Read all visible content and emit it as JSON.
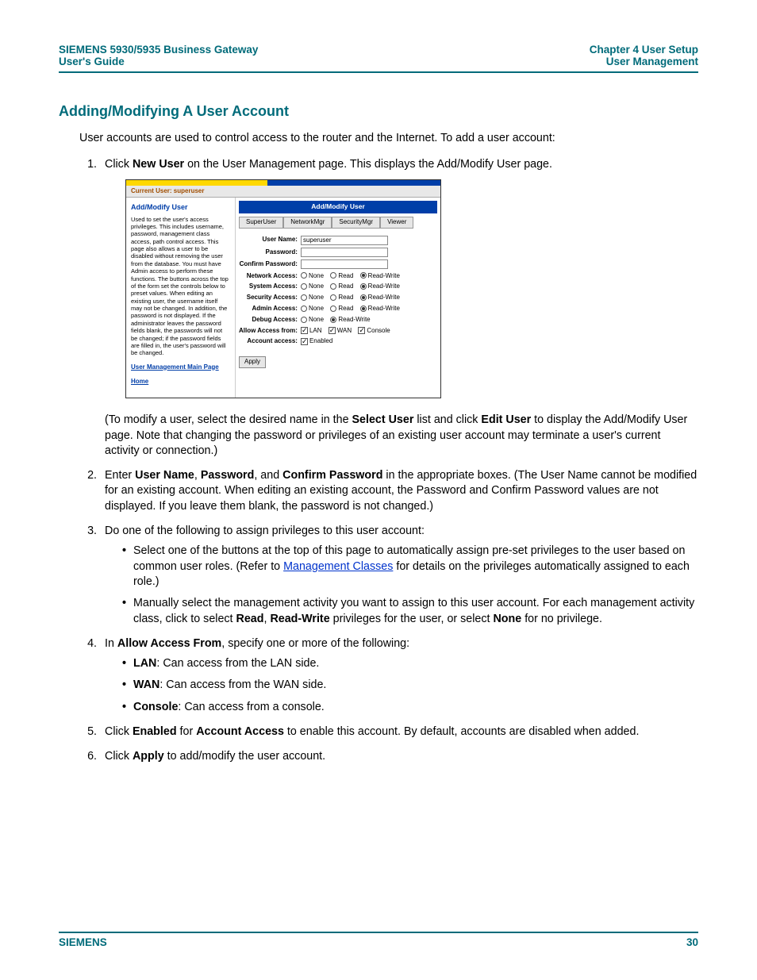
{
  "header": {
    "left_line1": "SIEMENS 5930/5935 Business Gateway",
    "left_line2": "User's Guide",
    "right_line1": "Chapter 4  User Setup",
    "right_line2": "User Management"
  },
  "section_title": "Adding/Modifying A User Account",
  "intro": "User accounts are used to control access to the router and the Internet. To add a user account:",
  "step1": {
    "pre": "Click ",
    "bold": "New User",
    "post": " on the User Management page. This displays the Add/Modify User page."
  },
  "shot": {
    "current_user_label": "Current User: superuser",
    "side_title": "Add/Modify User",
    "side_text": "Used to set the user's access privileges. This includes username, password, management class access, path control access. This page also allows a user to be disabled without removing the user from the database. You must have Admin access to perform these functions. The buttons across the top of the form set the controls below to preset values.\nWhen editing an existing user, the username itself may not be changed. In addition, the password is not displayed. If the administrator leaves the password fields blank, the passwords will not be changed; if the password fields are filled in, the user's password will be changed.",
    "side_link1": "User Management Main Page",
    "side_link2": "Home",
    "panel_title": "Add/Modify User",
    "roles": [
      "SuperUser",
      "NetworkMgr",
      "SecurityMgr",
      "Viewer"
    ],
    "fields": {
      "username_label": "User Name:",
      "username_value": "superuser",
      "password_label": "Password:",
      "confirm_label": "Confirm Password:"
    },
    "access_rows": [
      {
        "label": "Network Access:",
        "sel": "rw"
      },
      {
        "label": "System Access:",
        "sel": "rw"
      },
      {
        "label": "Security Access:",
        "sel": "rw"
      },
      {
        "label": "Admin Access:",
        "sel": "rw"
      }
    ],
    "debug_label": "Debug Access:",
    "debug_sel": "rw",
    "opts": {
      "none": "None",
      "read": "Read",
      "rw": "Read-Write"
    },
    "allow_label": "Allow Access from:",
    "allow_opts": {
      "lan": "LAN",
      "wan": "WAN",
      "console": "Console"
    },
    "acct_label": "Account access:",
    "acct_enabled": "Enabled",
    "apply": "Apply"
  },
  "step1_note": {
    "pre": "(To modify a user, select the desired name in the ",
    "b1": "Select User",
    "mid1": " list and click ",
    "b2": "Edit User",
    "post": " to display the Add/Modify User page. Note that changing the password or privileges of an existing user account may terminate a user's current activity or connection.)"
  },
  "step2": {
    "pre": "Enter ",
    "b1": "User Name",
    "c1": ", ",
    "b2": "Password",
    "c2": ", and ",
    "b3": "Confirm Password",
    "post": " in the appropriate boxes. (The User Name cannot be modified for an existing account. When editing an existing account, the Password and Confirm Password values are not displayed. If you leave them blank, the password is not changed.)"
  },
  "step3": {
    "lead": "Do one of the following to assign privileges to this user account:",
    "bul1_pre": "Select one of the buttons at the top of this page to automatically assign pre-set privileges to the user based on common user roles. (Refer to ",
    "bul1_link": "Management Classes",
    "bul1_post": " for details on the privileges automatically assigned to each role.)",
    "bul2_pre": "Manually select the management activity you want to assign to this user account. For each management activity class, click to select ",
    "bul2_b1": "Read",
    "bul2_c1": ", ",
    "bul2_b2": "Read-Write",
    "bul2_mid": " privileges for the user, or select ",
    "bul2_b3": "None",
    "bul2_post": " for no privilege."
  },
  "step4": {
    "pre": "In ",
    "b1": "Allow Access From",
    "post": ", specify one or more of the following:",
    "buls": [
      {
        "b": "LAN",
        "t": ": Can access from the LAN side."
      },
      {
        "b": "WAN",
        "t": ": Can access from the WAN side."
      },
      {
        "b": "Console",
        "t": ": Can access from a console."
      }
    ]
  },
  "step5": {
    "pre": "Click ",
    "b1": "Enabled",
    "mid": " for ",
    "b2": "Account Access",
    "post": " to enable this account. By default, accounts are disabled when added."
  },
  "step6": {
    "pre": "Click ",
    "b1": "Apply",
    "post": " to add/modify the user account."
  },
  "footer": {
    "left": "SIEMENS",
    "right": "30"
  }
}
